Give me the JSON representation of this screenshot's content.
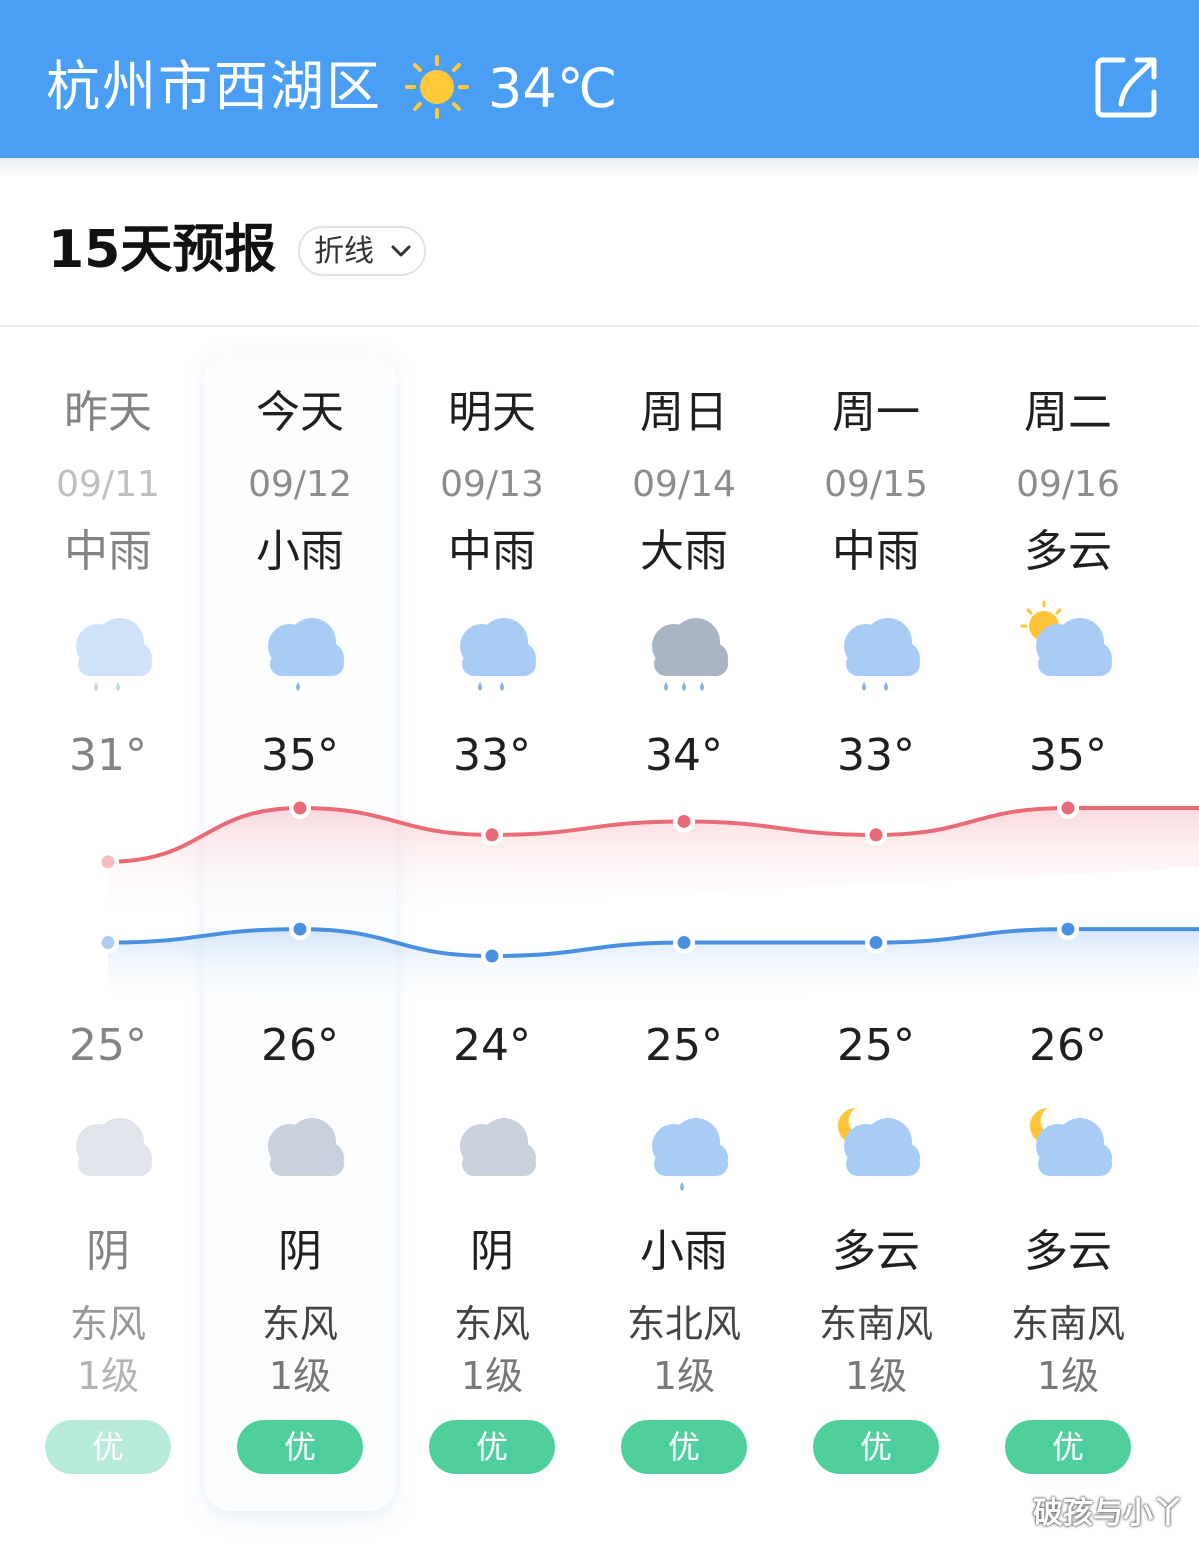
{
  "header": {
    "location": "杭州市西湖区",
    "current_temp": "34℃",
    "weather_icon": "sun-icon",
    "share_icon": "share-icon",
    "bg_color": "#4a9ef3"
  },
  "forecast": {
    "title": "15天预报",
    "view_mode": "折线"
  },
  "days": [
    {
      "name": "昨天",
      "date": "09/11",
      "day_weather": "中雨",
      "day_icon": "moderate-rain-icon",
      "high": "31°",
      "low": "25°",
      "night_icon": "overcast-icon",
      "night_weather": "阴",
      "wind_dir": "东风",
      "wind_level": "1级",
      "aqi": "优"
    },
    {
      "name": "今天",
      "date": "09/12",
      "day_weather": "小雨",
      "day_icon": "light-rain-icon",
      "high": "35°",
      "low": "26°",
      "night_icon": "overcast-icon",
      "night_weather": "阴",
      "wind_dir": "东风",
      "wind_level": "1级",
      "aqi": "优"
    },
    {
      "name": "明天",
      "date": "09/13",
      "day_weather": "中雨",
      "day_icon": "moderate-rain-icon",
      "high": "33°",
      "low": "24°",
      "night_icon": "overcast-icon",
      "night_weather": "阴",
      "wind_dir": "东风",
      "wind_level": "1级",
      "aqi": "优"
    },
    {
      "name": "周日",
      "date": "09/14",
      "day_weather": "大雨",
      "day_icon": "heavy-rain-icon",
      "high": "34°",
      "low": "25°",
      "night_icon": "light-rain-icon",
      "night_weather": "小雨",
      "wind_dir": "东北风",
      "wind_level": "1级",
      "aqi": "优"
    },
    {
      "name": "周一",
      "date": "09/15",
      "day_weather": "中雨",
      "day_icon": "moderate-rain-icon",
      "high": "33°",
      "low": "25°",
      "night_icon": "partly-cloudy-night-icon",
      "night_weather": "多云",
      "wind_dir": "东南风",
      "wind_level": "1级",
      "aqi": "优"
    },
    {
      "name": "周二",
      "date": "09/16",
      "day_weather": "多云",
      "day_icon": "partly-cloudy-day-icon",
      "high": "35°",
      "low": "26°",
      "night_icon": "partly-cloudy-night-icon",
      "night_weather": "多云",
      "wind_dir": "东南风",
      "wind_level": "1级",
      "aqi": "优"
    }
  ],
  "chart_data": {
    "type": "line",
    "categories": [
      "09/11",
      "09/12",
      "09/13",
      "09/14",
      "09/15",
      "09/16"
    ],
    "series": [
      {
        "values": [
          31,
          35,
          33,
          34,
          33,
          35
        ],
        "color": "#ea6b76"
      },
      {
        "values": [
          25,
          26,
          24,
          25,
          25,
          26
        ],
        "color": "#4a90e2"
      }
    ]
  },
  "aqi_color": "#4fcf9c",
  "watermark": "破孩与小丫"
}
